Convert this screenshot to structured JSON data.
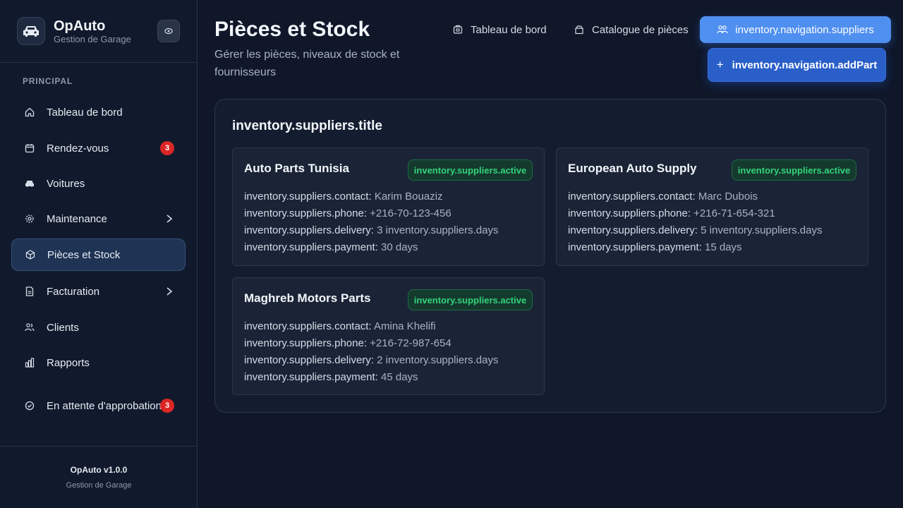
{
  "brand": {
    "name": "OpAuto",
    "subtitle": "Gestion de Garage"
  },
  "sidebar": {
    "section": "PRINCIPAL",
    "items": [
      {
        "label": "Tableau de bord",
        "icon": "home-icon"
      },
      {
        "label": "Rendez-vous",
        "icon": "calendar-icon",
        "badge": "3"
      },
      {
        "label": "Voitures",
        "icon": "car-icon"
      },
      {
        "label": "Maintenance",
        "icon": "gear-icon"
      },
      {
        "label": "Pièces et Stock",
        "icon": "box-icon",
        "active": true
      },
      {
        "label": "Facturation",
        "icon": "document-icon"
      },
      {
        "label": "Clients",
        "icon": "users-icon"
      },
      {
        "label": "Rapports",
        "icon": "bar-chart-icon"
      },
      {
        "label": "En attente d'approbation",
        "icon": "check-circle-icon",
        "badge": "3"
      }
    ],
    "version": "OpAuto v1.0.0",
    "footer_sub": "Gestion de Garage"
  },
  "header": {
    "title": "Pièces et Stock",
    "subtitle": "Gérer les pièces, niveaux de stock et fournisseurs",
    "tabs": [
      {
        "label": "Tableau de bord",
        "icon": "dashboard-icon"
      },
      {
        "label": "Catalogue de pièces",
        "icon": "package-icon"
      },
      {
        "label": "inventory.navigation.suppliers",
        "icon": "suppliers-icon",
        "active": true
      }
    ],
    "add_button": "inventory.navigation.addPart"
  },
  "suppliers": {
    "title": "inventory.suppliers.title",
    "labels": {
      "contact": "inventory.suppliers.contact:",
      "phone": "inventory.suppliers.phone:",
      "delivery": "inventory.suppliers.delivery:",
      "payment": "inventory.suppliers.payment:"
    },
    "list": [
      {
        "name": "Auto Parts Tunisia",
        "status": "inventory.suppliers.active",
        "contact": "Karim Bouaziz",
        "phone": "+216-70-123-456",
        "delivery": "3 inventory.suppliers.days",
        "payment": "30 days"
      },
      {
        "name": "European Auto Supply",
        "status": "inventory.suppliers.active",
        "contact": "Marc Dubois",
        "phone": "+216-71-654-321",
        "delivery": "5 inventory.suppliers.days",
        "payment": "15 days"
      },
      {
        "name": "Maghreb Motors Parts",
        "status": "inventory.suppliers.active",
        "contact": "Amina Khelifi",
        "phone": "+216-72-987-654",
        "delivery": "2 inventory.suppliers.days",
        "payment": "45 days"
      }
    ]
  },
  "colors": {
    "background": "#0f1729",
    "accent": "#4f8ff0",
    "active_status": "#34d27a",
    "badge": "#dc2626"
  }
}
